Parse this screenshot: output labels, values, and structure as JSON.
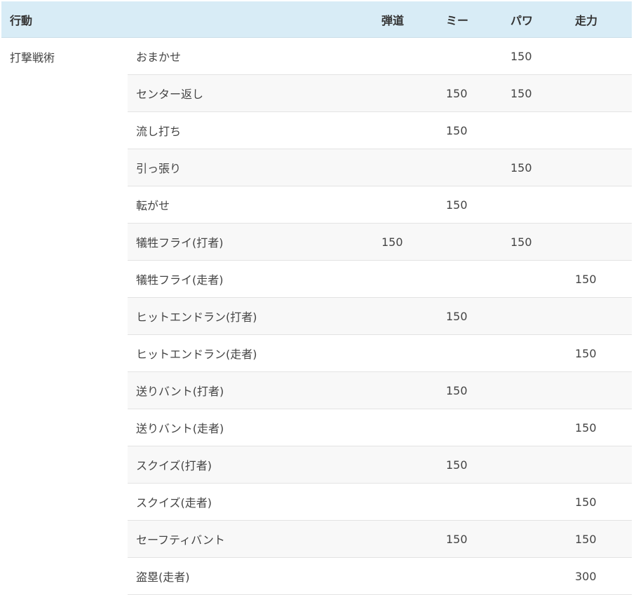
{
  "headers": {
    "action": "行動",
    "detail": "",
    "trajectory": "弾道",
    "meet": "ミー",
    "power": "パワ",
    "speed": "走力"
  },
  "group_label": "打撃戦術",
  "rows": [
    {
      "name": "おまかせ",
      "trajectory": "",
      "meet": "",
      "power": "150",
      "speed": ""
    },
    {
      "name": "センター返し",
      "trajectory": "",
      "meet": "150",
      "power": "150",
      "speed": ""
    },
    {
      "name": "流し打ち",
      "trajectory": "",
      "meet": "150",
      "power": "",
      "speed": ""
    },
    {
      "name": "引っ張り",
      "trajectory": "",
      "meet": "",
      "power": "150",
      "speed": ""
    },
    {
      "name": "転がせ",
      "trajectory": "",
      "meet": "150",
      "power": "",
      "speed": ""
    },
    {
      "name": "犠牲フライ(打者)",
      "trajectory": "150",
      "meet": "",
      "power": "150",
      "speed": ""
    },
    {
      "name": "犠牲フライ(走者)",
      "trajectory": "",
      "meet": "",
      "power": "",
      "speed": "150"
    },
    {
      "name": "ヒットエンドラン(打者)",
      "trajectory": "",
      "meet": "150",
      "power": "",
      "speed": ""
    },
    {
      "name": "ヒットエンドラン(走者)",
      "trajectory": "",
      "meet": "",
      "power": "",
      "speed": "150"
    },
    {
      "name": "送りバント(打者)",
      "trajectory": "",
      "meet": "150",
      "power": "",
      "speed": ""
    },
    {
      "name": "送りバント(走者)",
      "trajectory": "",
      "meet": "",
      "power": "",
      "speed": "150"
    },
    {
      "name": "スクイズ(打者)",
      "trajectory": "",
      "meet": "150",
      "power": "",
      "speed": ""
    },
    {
      "name": "スクイズ(走者)",
      "trajectory": "",
      "meet": "",
      "power": "",
      "speed": "150"
    },
    {
      "name": "セーフティバント",
      "trajectory": "",
      "meet": "150",
      "power": "",
      "speed": "150"
    },
    {
      "name": "盗塁(走者)",
      "trajectory": "",
      "meet": "",
      "power": "",
      "speed": "300"
    }
  ]
}
